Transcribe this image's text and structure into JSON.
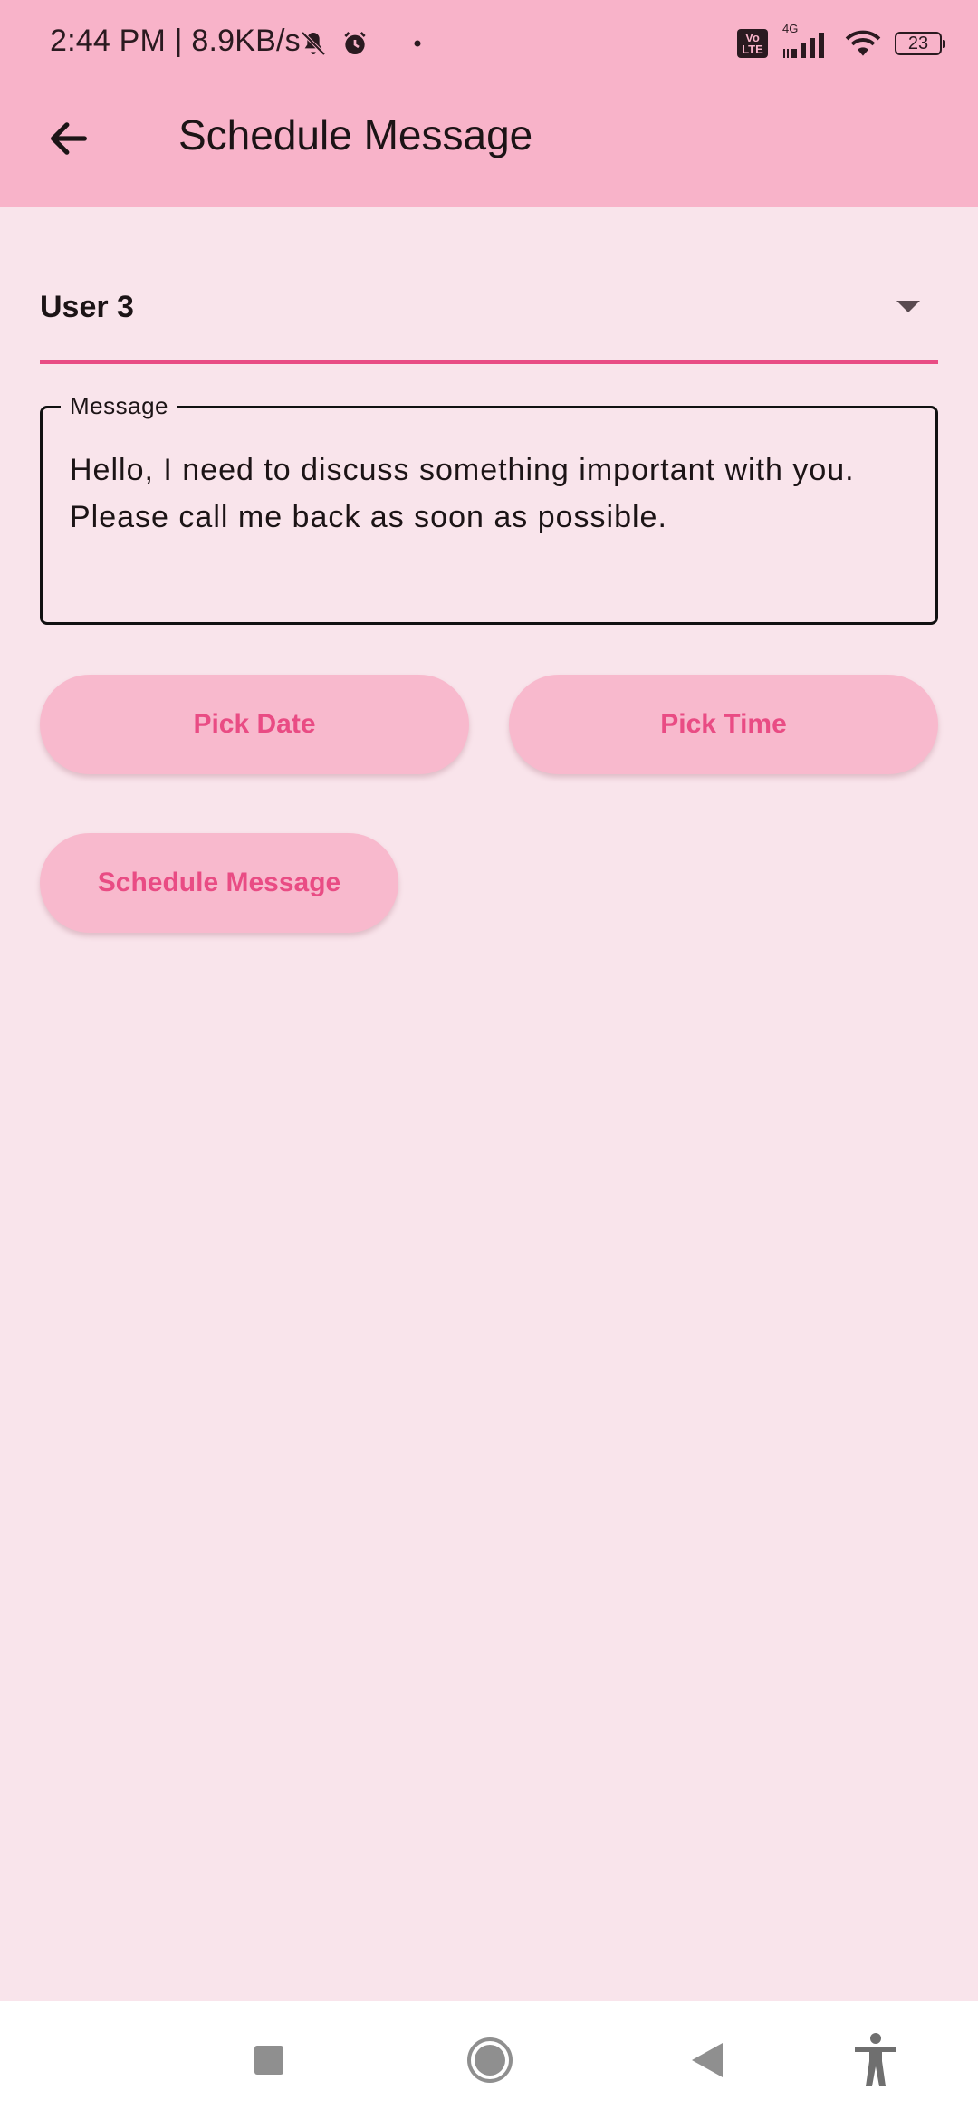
{
  "status_bar": {
    "text": "2:44 PM | 8.9KB/s",
    "icons_left": [
      "bell-muted-icon",
      "alarm-clock-icon",
      "notification-dot-icon"
    ],
    "volte_label": "Vo LTE",
    "network_label": "4G",
    "battery_level": "23"
  },
  "app_bar": {
    "back_icon": "arrow-left-icon",
    "title": "Schedule Message"
  },
  "form": {
    "recipient": {
      "value": "User 3",
      "icon": "dropdown-caret-icon"
    },
    "message": {
      "label": "Message",
      "value": "Hello, I need to discuss something important with you.\nPlease call me back as soon as possible."
    },
    "pick_date_label": "Pick Date",
    "pick_time_label": "Pick Time",
    "schedule_label": "Schedule Message"
  },
  "nav_bar": {
    "icons": [
      "recents-square-icon",
      "home-circle-icon",
      "back-triangle-icon",
      "accessibility-icon"
    ]
  },
  "colors": {
    "header": "#f8b3c9",
    "background": "#f9e4eb",
    "accent": "#e94c84",
    "button": "#f8b9cd"
  }
}
